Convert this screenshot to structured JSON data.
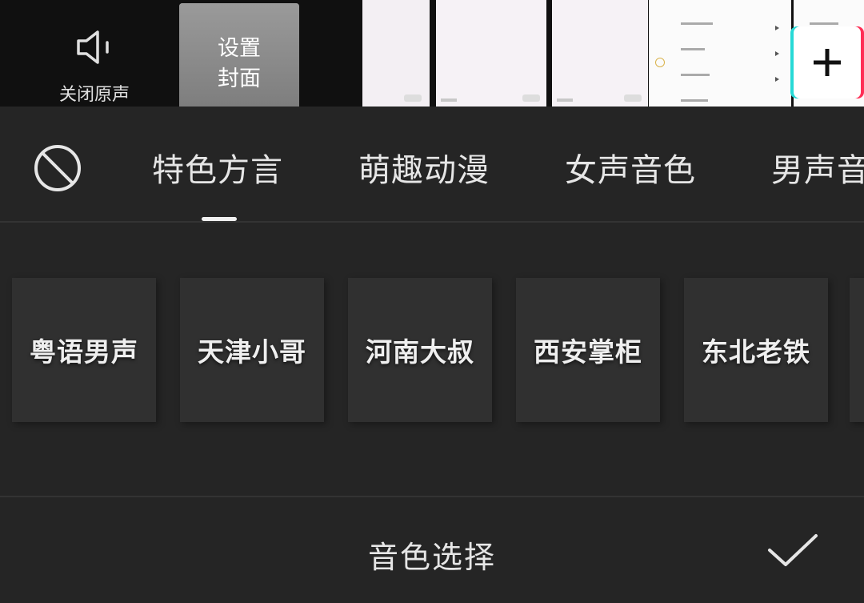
{
  "toolbar": {
    "mute_label": "关闭原声",
    "cover_label_line1": "设置",
    "cover_label_line2": "封面",
    "icons": {
      "mute": "speaker-icon",
      "add": "plus-icon"
    }
  },
  "voice_panel": {
    "categories": [
      "特色方言",
      "萌趣动漫",
      "女声音色",
      "男声音色"
    ],
    "selected_category": "特色方言",
    "voices": [
      "粤语男声",
      "天津小哥",
      "河南大叔",
      "西安掌柜",
      "东北老铁"
    ],
    "title": "音色选择",
    "icons": {
      "none": "no-effect-icon",
      "confirm": "checkmark-icon"
    }
  },
  "colors": {
    "panel_bg": "#252525",
    "card_bg": "#303030",
    "text": "#e6e6e6",
    "accent_cyan": "#26d9d6",
    "accent_pink": "#ff2d55"
  }
}
